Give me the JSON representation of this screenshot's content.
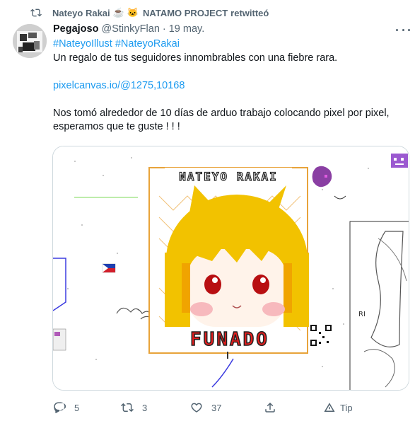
{
  "retweet": {
    "icon": "retweet-icon",
    "user": "Nateyo Rakai",
    "emoji_1": "☕",
    "emoji_2": "🐱",
    "project": "NATAMO PROJECT",
    "suffix": "retwitteó"
  },
  "tweet": {
    "author_name": "Pegajoso",
    "handle": "@StinkyFlan",
    "separator": "·",
    "date": "19 may.",
    "hashtag_1": "#NateyoIllust",
    "hashtag_2": "#NateyoRakai",
    "line_1": "Un regalo de tus seguidores innombrables con una fiebre rara.",
    "link": "pixelcanvas.io/@1275,10168",
    "line_2": "Nos tomó alrededor de 10 días de arduo trabajo colocando pixel por pixel,",
    "line_3": "esperamos que te guste ! ! !"
  },
  "media": {
    "banner_text": "NATEYO RAKAI",
    "bottom_text": "FUNADO",
    "side_text": "RI"
  },
  "actions": {
    "reply_count": "5",
    "retweet_count": "3",
    "like_count": "37",
    "tip_label": "Tip"
  },
  "colors": {
    "link": "#1d9bf0",
    "muted": "#536471",
    "border": "#cfd9de",
    "hair": "#f2c200"
  }
}
